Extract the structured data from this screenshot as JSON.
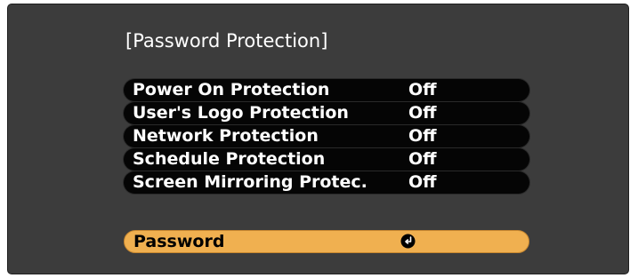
{
  "panel": {
    "title": "[Password Protection]"
  },
  "menu": {
    "items": [
      {
        "label": "Power On Protection",
        "value": "Off"
      },
      {
        "label": "User's Logo Protection",
        "value": "Off"
      },
      {
        "label": "Network Protection",
        "value": "Off"
      },
      {
        "label": "Schedule Protection",
        "value": "Off"
      },
      {
        "label": "Screen Mirroring Protec.",
        "value": "Off"
      }
    ]
  },
  "password": {
    "label": "Password",
    "icon": "enter-icon"
  },
  "colors": {
    "panel_background": "#3c3c3c",
    "row_background": "#050505",
    "highlight": "#f0b050",
    "text": "#ffffff"
  }
}
